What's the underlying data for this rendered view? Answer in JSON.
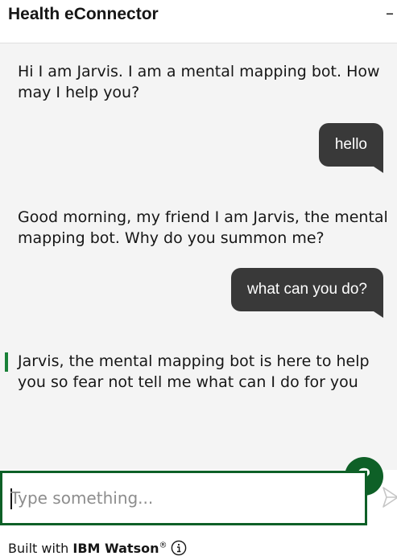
{
  "header": {
    "title": "Health eConnector",
    "minimize_glyph": "–"
  },
  "messages": [
    {
      "role": "bot",
      "text": "Hi I am Jarvis. I am a mental mapping bot. How may I help you?"
    },
    {
      "role": "user",
      "text": "hello"
    },
    {
      "role": "bot",
      "text": "Good morning, my friend I am Jarvis, the mental mapping bot. Why do you summon me?"
    },
    {
      "role": "user",
      "text": "what can you do?"
    },
    {
      "role": "bot",
      "text": "Jarvis, the mental mapping bot is here to help you so fear not tell me what can I do for you"
    }
  ],
  "help_button": {
    "label": "?",
    "icon": "question-icon"
  },
  "input": {
    "placeholder": "Type something...",
    "value": ""
  },
  "send": {
    "icon": "send-icon"
  },
  "footer": {
    "prefix": "Built with ",
    "brand": "IBM Watson",
    "trademark": "®",
    "info_icon": "info-icon"
  },
  "colors": {
    "accent": "#0e6027",
    "user_bubble": "#393939",
    "chat_bg": "#f4f4f4"
  }
}
